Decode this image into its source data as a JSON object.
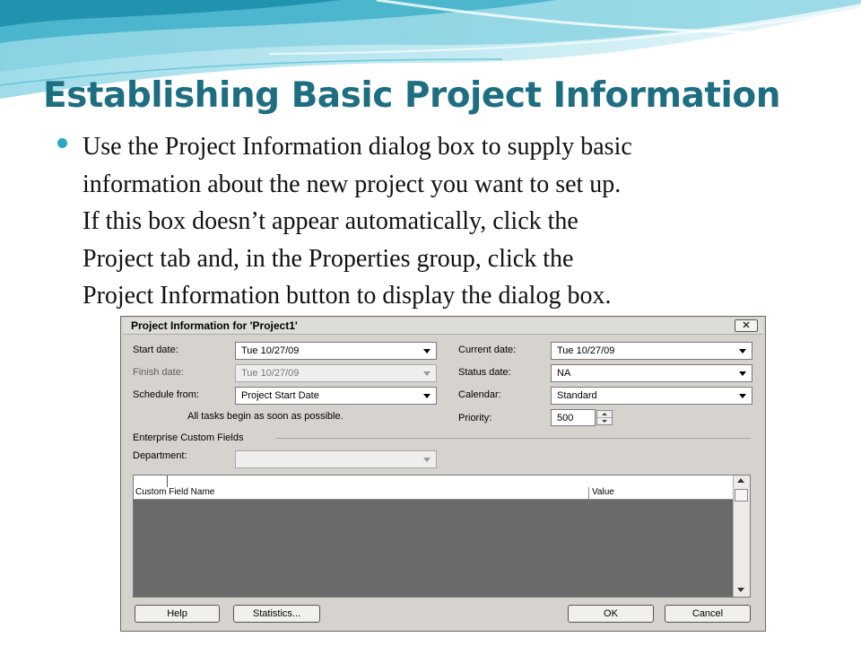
{
  "slide": {
    "title": "Establishing Basic Project Information",
    "bullet_lines": [
      "Use the Project Information dialog box to supply basic",
      "information about the new project you want to set up.",
      "If this box doesn’t appear automatically, click the",
      "Project tab and, in the Properties group, click the",
      "Project Information button to display the dialog box."
    ]
  },
  "dialog": {
    "title": "Project Information for 'Project1'",
    "close_label": "✕",
    "start_date": {
      "label": "Start date:",
      "value": "Tue 10/27/09"
    },
    "finish_date": {
      "label": "Finish date:",
      "value": "Tue 10/27/09"
    },
    "schedule_from": {
      "label": "Schedule from:",
      "value": "Project Start Date"
    },
    "schedule_note": "All tasks begin as soon as possible.",
    "current_date": {
      "label": "Current date:",
      "value": "Tue 10/27/09"
    },
    "status_date": {
      "label": "Status date:",
      "value": "NA"
    },
    "calendar": {
      "label": "Calendar:",
      "value": "Standard"
    },
    "priority": {
      "label": "Priority:",
      "value": "500"
    },
    "enterprise_label": "Enterprise Custom Fields",
    "department": {
      "label": "Department:",
      "value": ""
    },
    "grid": {
      "columns": [
        "Custom Field Name",
        "Value"
      ],
      "rows": []
    },
    "buttons": {
      "help": "Help",
      "statistics": "Statistics...",
      "ok": "OK",
      "cancel": "Cancel"
    }
  },
  "colors": {
    "title": "#1e6e82",
    "bullet": "#2aa8bd",
    "dialog_face": "#d6d3ce",
    "grid_empty": "#6a6a6a"
  }
}
